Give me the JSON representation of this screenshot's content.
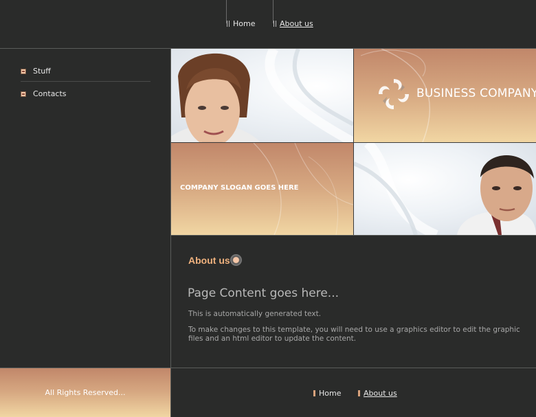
{
  "header": {
    "nav": [
      {
        "label": "Home"
      },
      {
        "label": "About us"
      }
    ]
  },
  "sidebar": {
    "items": [
      {
        "label": "Stuff"
      },
      {
        "label": "Contacts"
      }
    ]
  },
  "banner": {
    "brand": "BUSINESS COMPANY",
    "slogan": "COMPANY SLOGAN GOES HERE"
  },
  "content": {
    "heading": "About us",
    "page_title": "Page Content goes here...",
    "paragraphs": [
      "This is automatically generated text.",
      "To make changes to this template, you will need to use a graphics editor to edit the graphic files and an html editor to update the content."
    ]
  },
  "footer": {
    "copyright": "All Rights Reserved...",
    "nav": [
      {
        "label": "Home"
      },
      {
        "label": "About us"
      }
    ]
  },
  "colors": {
    "background": "#2a2b2a",
    "accent": "#f0b27e",
    "gradient_top": "#c1876a",
    "gradient_bottom": "#f1d6a3"
  }
}
